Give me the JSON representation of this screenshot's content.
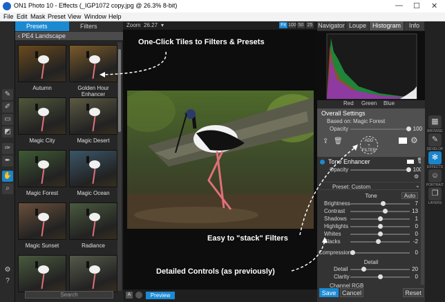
{
  "window": {
    "title": "ON1 Photo 10 - Effects (_IGP1072 copy.jpg @ 26.3% 8-bit)",
    "minimize": "—",
    "maximize": "☐",
    "close": "✕"
  },
  "menu": [
    "File",
    "Edit",
    "Mask",
    "Preset",
    "View",
    "Window",
    "Help"
  ],
  "left_panel": {
    "tabs": [
      "Presets",
      "Filters"
    ],
    "group": "PE4 Landscape",
    "tiles": [
      {
        "label": "Autumn",
        "tone": "#6b4a1c"
      },
      {
        "label": "Golden Hour Enhancer",
        "tone": "#7a5a2a"
      },
      {
        "label": "Magic City",
        "tone": "#50573a"
      },
      {
        "label": "Magic Desert",
        "tone": "#5d5a44"
      },
      {
        "label": "Magic Forest",
        "tone": "#3f5a34"
      },
      {
        "label": "Magic Ocean",
        "tone": "#3b5668"
      },
      {
        "label": "Magic Sunset",
        "tone": "#6a4f3a"
      },
      {
        "label": "Radiance",
        "tone": "#4a5a3e"
      },
      {
        "label": "",
        "tone": "#4a5a3e"
      },
      {
        "label": "",
        "tone": "#555a4a"
      }
    ],
    "search_placeholder": "Search"
  },
  "center": {
    "zoom_label": "Zoom",
    "zoom_value": "26.27",
    "zoom_buttons": [
      "Fit",
      "100",
      "50",
      "25"
    ],
    "preview_label": "Preview"
  },
  "right_panel": {
    "tabs": [
      "Navigator",
      "Loupe",
      "Histogram",
      "Info"
    ],
    "channels": [
      "Red",
      "Green",
      "Blue"
    ],
    "overall": {
      "title": "Overall Settings",
      "based_on_label": "Based on:",
      "based_on_value": "Magic Forest",
      "opacity_label": "Opacity",
      "opacity_value": "100"
    },
    "add_filter": "ADD\n+\nFILTER",
    "tone_enhancer": {
      "title": "Tone Enhancer",
      "opacity_label": "Opacity",
      "opacity_value": "100",
      "preset_label": "Preset: Custom",
      "tone_header": "Tone",
      "auto_label": "Auto",
      "sliders": [
        {
          "label": "Brightness",
          "value": "7",
          "pos": 0.55
        },
        {
          "label": "Contrast",
          "value": "13",
          "pos": 0.58
        },
        {
          "label": "Shadows",
          "value": "1",
          "pos": 0.5
        },
        {
          "label": "Highlights",
          "value": "0",
          "pos": 0.5
        },
        {
          "label": "Whites",
          "value": "0",
          "pos": 0.5
        },
        {
          "label": "Blacks",
          "value": "-2",
          "pos": 0.47
        }
      ],
      "compression_label": "Compression",
      "compression_value": "0",
      "detail_header": "Detail",
      "detail_label": "Detail",
      "detail_value": "20",
      "clarity_label": "Clarity",
      "clarity_value": "0",
      "next_section": "Channel RGB"
    },
    "buttons": {
      "save": "Save",
      "cancel": "Cancel",
      "reset": "Reset"
    }
  },
  "far_right": {
    "labels": [
      "BROWSE",
      "DEVELOP",
      "EFFECTS",
      "PORTRAIT",
      "LAYERS"
    ]
  },
  "annotations": {
    "one_click": "One-Click Tiles to Filters & Presets",
    "stack": "Easy to \"stack\" Filters",
    "detailed": "Detailed Controls (as previously)"
  },
  "colors": {
    "accent": "#1b8ad3",
    "panel": "#2b2b2b"
  }
}
